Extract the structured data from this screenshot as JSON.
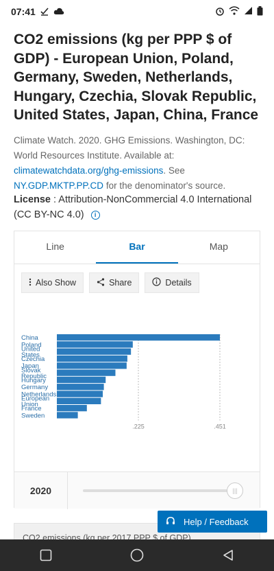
{
  "status": {
    "time": "07:41"
  },
  "page": {
    "title": "CO2 emissions (kg per PPP $ of GDP) - European Union, Poland, Germany, Sweden, Netherlands, Hungary, Czechia, Slovak Republic, United States, Japan, China, France",
    "source_text": "Climate Watch. 2020. GHG Emissions. Washington, DC: World Resources Institute. Available at: ",
    "source_link": "climatewatchdata.org/ghg-emissions",
    "source_mid": ". See ",
    "source_link2": "NY.GDP.MKTP.PP.CD",
    "source_end": " for the denominator's source.",
    "license_label": "License",
    "license_text": " : Attribution-NonCommercial 4.0 International (CC BY-NC 4.0)"
  },
  "tabs": [
    {
      "label": "Line"
    },
    {
      "label": "Bar"
    },
    {
      "label": "Map"
    }
  ],
  "active_tab": "Bar",
  "toolbar": {
    "also_show": "Also Show",
    "share": "Share",
    "details": "Details"
  },
  "chart_data": {
    "type": "bar",
    "orientation": "horizontal",
    "categories": [
      "China",
      "Poland",
      "United States",
      "Czechia",
      "Japan",
      "Slovak Republic",
      "Hungary",
      "Germany",
      "Netherlands",
      "European Union",
      "France",
      "Sweden"
    ],
    "category_labels": [
      "China",
      "Poland",
      "United\nStates",
      "Czechia",
      "Japan",
      "Slovak\nRepublic",
      "Hungary",
      "Germany",
      "Netherlands",
      "European\nUnion",
      "France",
      "Sweden"
    ],
    "values": [
      0.451,
      0.21,
      0.205,
      0.195,
      0.193,
      0.162,
      0.135,
      0.13,
      0.127,
      0.122,
      0.083,
      0.058
    ],
    "xticks": [
      ".225",
      ".451"
    ],
    "xlim": [
      0,
      0.451
    ],
    "grid": true,
    "bar_color": "#2b7bbd"
  },
  "slider": {
    "year": "2020"
  },
  "next_card": {
    "text": "CO2 emissions (kg per 2017 PPP $ of GDP)"
  },
  "feedback": {
    "label": "Help / Feedback"
  }
}
